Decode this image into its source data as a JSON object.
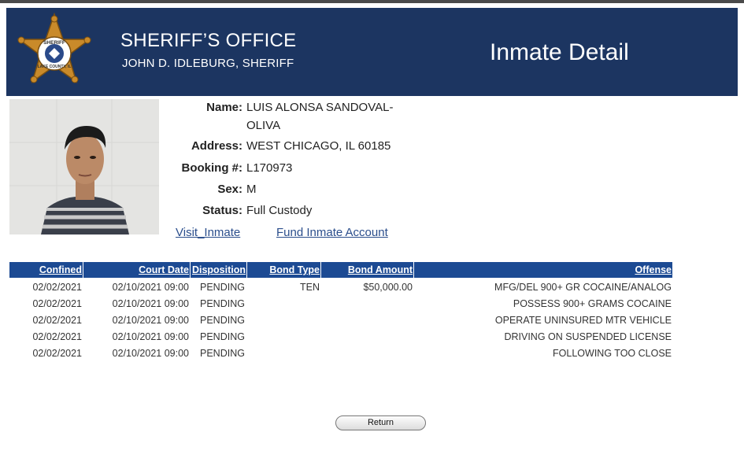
{
  "header": {
    "title": "SHERIFF’S OFFICE",
    "subtitle": "JOHN D. IDLEBURG, SHERIFF",
    "page_title": "Inmate Detail",
    "badge": {
      "icon": "sheriff-star-badge-icon",
      "text_top": "SHERIFF",
      "text_bottom": "LAKE COUNTY, IL"
    }
  },
  "inmate": {
    "name_label": "Name:",
    "name_line1": "LUIS ALONSA SANDOVAL-",
    "name_line2": "OLIVA",
    "address_label": "Address:",
    "address": "WEST CHICAGO, IL 60185",
    "booking_label": "Booking #:",
    "booking": "L170973",
    "sex_label": "Sex:",
    "sex": "M",
    "status_label": "Status:",
    "status": "Full Custody"
  },
  "links": {
    "visit": "Visit_Inmate",
    "fund": "Fund Inmate Account"
  },
  "table": {
    "headers": {
      "confined": "Confined",
      "court_date": "Court Date",
      "disposition": "Disposition",
      "bond_type": "Bond Type",
      "bond_amount": "Bond Amount",
      "offense": "Offense"
    },
    "rows": [
      {
        "confined": "02/02/2021",
        "court_date": "02/10/2021 09:00",
        "disposition": "PENDING",
        "bond_type": "TEN",
        "bond_amount": "$50,000.00",
        "offense": "MFG/DEL 900+ GR COCAINE/ANALOG"
      },
      {
        "confined": "02/02/2021",
        "court_date": "02/10/2021 09:00",
        "disposition": "PENDING",
        "bond_type": "",
        "bond_amount": "",
        "offense": "POSSESS 900+ GRAMS COCAINE"
      },
      {
        "confined": "02/02/2021",
        "court_date": "02/10/2021 09:00",
        "disposition": "PENDING",
        "bond_type": "",
        "bond_amount": "",
        "offense": "OPERATE UNINSURED MTR VEHICLE"
      },
      {
        "confined": "02/02/2021",
        "court_date": "02/10/2021 09:00",
        "disposition": "PENDING",
        "bond_type": "",
        "bond_amount": "",
        "offense": "DRIVING ON SUSPENDED LICENSE"
      },
      {
        "confined": "02/02/2021",
        "court_date": "02/10/2021 09:00",
        "disposition": "PENDING",
        "bond_type": "",
        "bond_amount": "",
        "offense": "FOLLOWING TOO CLOSE"
      }
    ]
  },
  "actions": {
    "return_label": "Return"
  },
  "colors": {
    "header_bg": "#1c3561",
    "table_header_bg": "#1c4a93",
    "link": "#2b4e8c",
    "badge_gold": "#c98a2a"
  }
}
